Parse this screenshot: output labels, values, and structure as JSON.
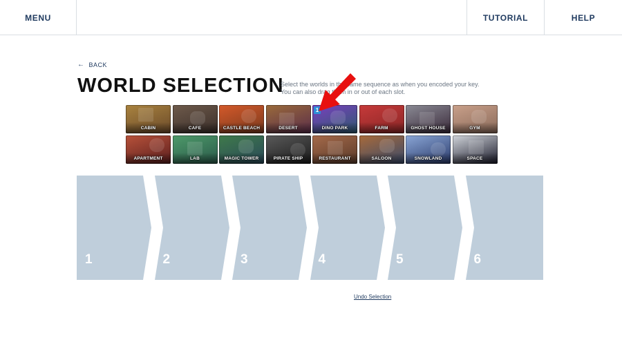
{
  "header": {
    "menu_label": "MENU",
    "tutorial_label": "TUTORIAL",
    "help_label": "HELP"
  },
  "back_label": "BACK",
  "title": "WORLD SELECTION",
  "instructions": {
    "line1": "Select the worlds in the same sequence as when you encoded your key.",
    "line2": "You can also drag them in or out of each slot."
  },
  "worlds": [
    {
      "label": "CABIN",
      "colors": [
        "#6b4a2a",
        "#a9833f"
      ]
    },
    {
      "label": "CAFE",
      "colors": [
        "#3b2f2a",
        "#6e5a4b"
      ]
    },
    {
      "label": "CASTLE BEACH",
      "colors": [
        "#7a3a1e",
        "#d4592a"
      ]
    },
    {
      "label": "DESERT",
      "colors": [
        "#5a2d4a",
        "#9a6a3a"
      ]
    },
    {
      "label": "DINO PARK",
      "colors": [
        "#2e5a6e",
        "#7a3fc0"
      ],
      "selected_order": "1"
    },
    {
      "label": "FARM",
      "colors": [
        "#8a2626",
        "#c63a3a"
      ]
    },
    {
      "label": "GHOST HOUSE",
      "colors": [
        "#3a2a3a",
        "#8a8a94"
      ]
    },
    {
      "label": "GYM",
      "colors": [
        "#8a6a5a",
        "#c9a08a"
      ]
    },
    {
      "label": "APARTMENT",
      "colors": [
        "#5a1e1e",
        "#b8523a"
      ]
    },
    {
      "label": "LAB",
      "colors": [
        "#2a5a4a",
        "#4e9a6a"
      ]
    },
    {
      "label": "MAGIC TOWER",
      "colors": [
        "#2a4a5a",
        "#3f7a4a"
      ]
    },
    {
      "label": "PIRATE SHIP",
      "colors": [
        "#1a1a1a",
        "#5a5a5a"
      ]
    },
    {
      "label": "RESTAURANT",
      "colors": [
        "#5a3a2a",
        "#a56a4a"
      ]
    },
    {
      "label": "SALOON",
      "colors": [
        "#3a4a6a",
        "#a86a3a"
      ]
    },
    {
      "label": "SNOWLAND",
      "colors": [
        "#2a3a6a",
        "#8aa6d6"
      ]
    },
    {
      "label": "SPACE",
      "colors": [
        "#1a1a2a",
        "#d0d4da"
      ]
    }
  ],
  "slots": [
    "1",
    "2",
    "3",
    "4",
    "5",
    "6"
  ],
  "undo_label": "Undo Selection",
  "colors": {
    "nav_text": "#1f3a5f",
    "slot_fill": "#bfcedb",
    "badge": "#2e8fd6",
    "annotation_arrow": "#e8100f"
  }
}
